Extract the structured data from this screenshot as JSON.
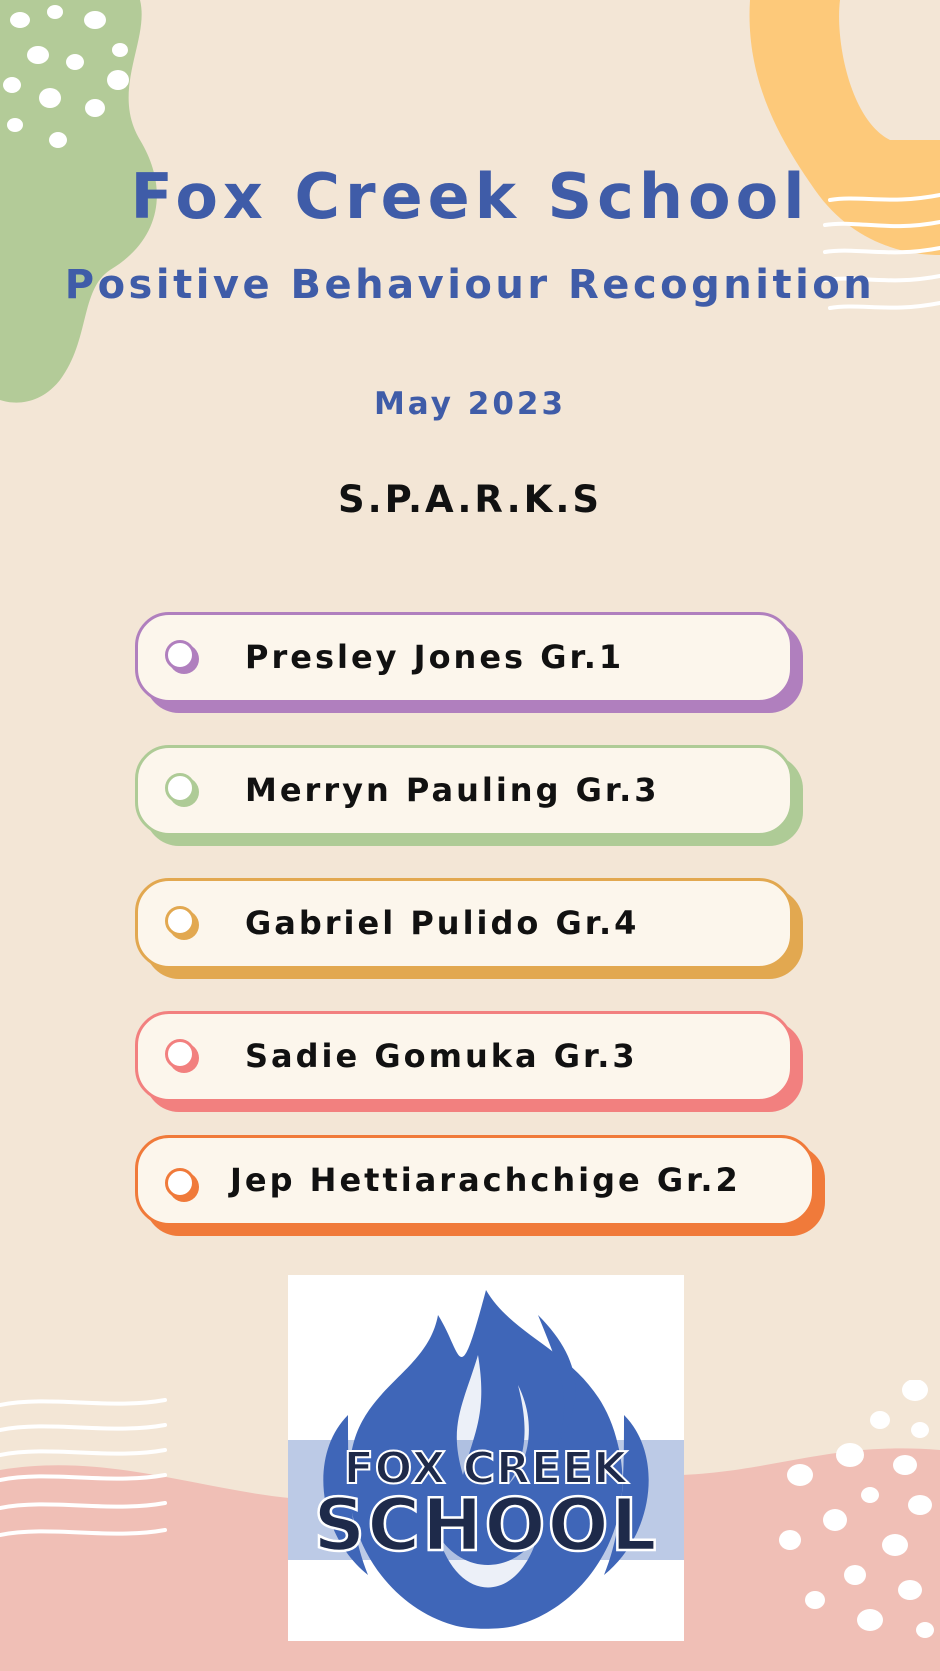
{
  "header": {
    "school_name": "Fox Creek School",
    "program": "Positive Behaviour Recognition",
    "month": "May 2023",
    "category": "S.P.A.R.K.S"
  },
  "recipients": [
    {
      "name": "Presley Jones Gr.1",
      "color": "#b07fbe"
    },
    {
      "name": "Merryn Pauling Gr.3",
      "color": "#aecb96"
    },
    {
      "name": "Gabriel Pulido Gr.4",
      "color": "#e2a850"
    },
    {
      "name": "Sadie Gomuka Gr.3",
      "color": "#f2807f"
    },
    {
      "name": "Jep Hettiarachchige Gr.2",
      "color": "#f07a3a"
    }
  ],
  "logo": {
    "text_line1": "FOX CREEK",
    "text_line2": "SCHOOL",
    "flame_color": "#3f66b8",
    "text_color": "#1e2a4a"
  },
  "colors": {
    "background": "#f3e6d6",
    "title": "#3f5ca8",
    "green_blob": "#b3cb98",
    "orange_blob": "#fdc97a",
    "pink_wave": "#f0bfb6"
  }
}
